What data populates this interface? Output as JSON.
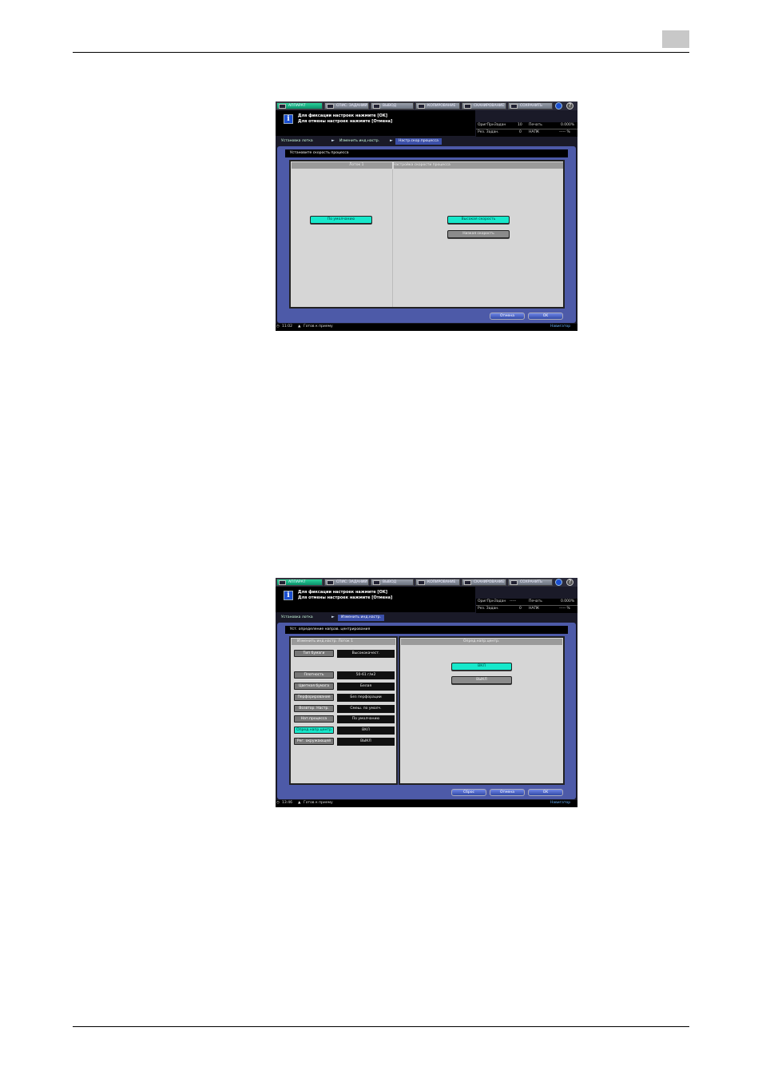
{
  "screens": [
    {
      "tabs": [
        "АППАРАТ",
        "СПИС. ЗАДАНИЙ",
        "ВЫВОД",
        "КОПИРОВАНИЕ",
        "СКАНИРОВАНИЕ",
        "СОХРАНИТЬ"
      ],
      "message_line1": "Для фиксации настроек нажмите [OK]",
      "message_line2": "Для отмены настроек нажмите [Отмена]",
      "stat_label1": "ОригПрнЗадан",
      "stat_value1": "10",
      "stat_label2": "Печать",
      "stat_value2": "0.000%",
      "stat_label3": "Рез. Задан.",
      "stat_value3": "0",
      "stat_label4": "НАПК",
      "stat_value4": "----- %",
      "breadcrumbs": [
        "Установка лотка",
        "Изменить инд.настр.",
        "Настр.скор.процесса"
      ],
      "panel_title": "Установите скорость процесса",
      "left_header": "Лоток 1",
      "right_header": "Настройка скорости процесса",
      "default_button": "По умолчанию",
      "options": [
        "Высокая скорость",
        "Низкая скорость"
      ],
      "cancel_label": "Отмена",
      "ok_label": "OK",
      "time": "11:02",
      "status": "Готов к приему",
      "shortcut": "Навигатор"
    },
    {
      "tabs": [
        "АППАРАТ",
        "СПИС. ЗАДАНИЙ",
        "ВЫВОД",
        "КОПИРОВАНИЕ",
        "СКАНИРОВАНИЕ",
        "СОХРАНИТЬ"
      ],
      "message_line1": "Для фиксации настроек нажмите [OK]",
      "message_line2": "Для отмены настроек нажмите [Отмена]",
      "stat_label1": "ОригПрнЗадан",
      "stat_value1": "-----",
      "stat_label2": "Печать",
      "stat_value2": "0.000%",
      "stat_label3": "Рез. Задан.",
      "stat_value3": "0",
      "stat_label4": "НАПК",
      "stat_value4": "----- %",
      "breadcrumbs": [
        "Установка лотка",
        "Изменить инд.настр."
      ],
      "panel_title": "Уст. определение направ. центрирования",
      "left_header": "Изменить инд.настр.   Лоток 1",
      "right_header": "Опред.напр.центр.",
      "settings": [
        {
          "label": "Тип бумаги",
          "value": "Высококачест."
        },
        {
          "label": "Плотность",
          "value": "50-61 г/м2"
        },
        {
          "label": "Цветная бумага",
          "value": "Белая"
        },
        {
          "label": "Перфорирование",
          "value": "Без перфорации"
        },
        {
          "label": "Возвтор. Настр.",
          "value": "Смеш. по умолч."
        },
        {
          "label": "Нат.процесса",
          "value": "По умолчанию"
        },
        {
          "label": "Опред.напр.центр",
          "value": "ВКЛ"
        },
        {
          "label": "Рег. окружающей",
          "value": "ВЫКЛ"
        }
      ],
      "options": [
        "ВКЛ",
        "ВЫКЛ"
      ],
      "reset_label": "Сброс",
      "cancel_label": "Отмена",
      "ok_label": "OK",
      "time": "13:46",
      "status": "Готов к приему",
      "shortcut": "Навигатор"
    }
  ]
}
